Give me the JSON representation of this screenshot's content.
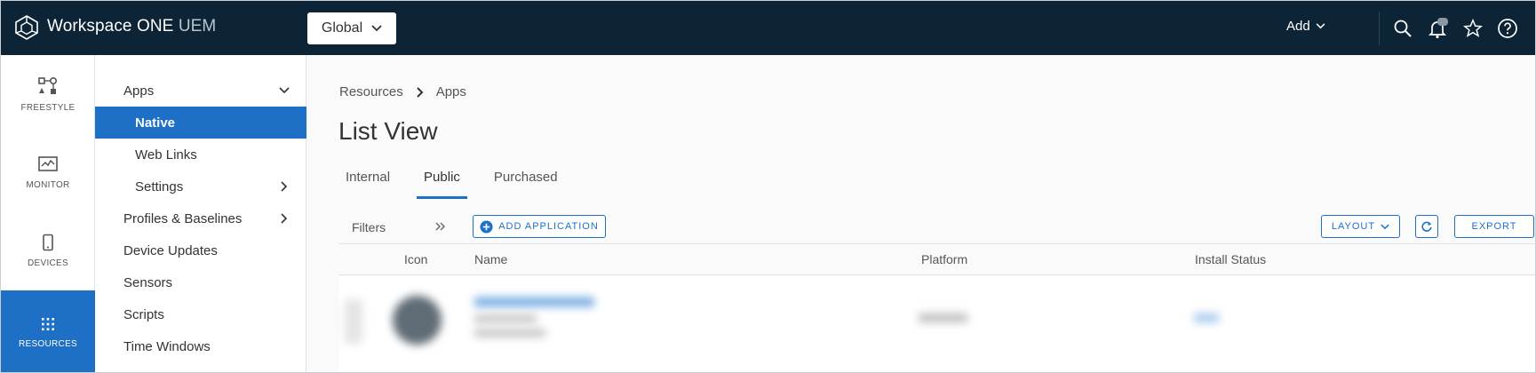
{
  "header": {
    "brand_main": "Workspace ONE",
    "brand_suffix": "UEM",
    "org_selector": "Global",
    "add_menu": "Add"
  },
  "rail": {
    "items": [
      {
        "label": "FREESTYLE",
        "icon": "freestyle-icon"
      },
      {
        "label": "MONITOR",
        "icon": "monitor-icon"
      },
      {
        "label": "DEVICES",
        "icon": "device-icon"
      },
      {
        "label": "RESOURCES",
        "icon": "resources-grid-icon",
        "active": true
      }
    ]
  },
  "subnav": {
    "items": [
      {
        "label": "Apps",
        "level": "top",
        "expanded": true
      },
      {
        "label": "Native",
        "level": "child",
        "active": true
      },
      {
        "label": "Web Links",
        "level": "child"
      },
      {
        "label": "Settings",
        "level": "child",
        "has_children": true
      },
      {
        "label": "Profiles & Baselines",
        "level": "top",
        "has_children": true
      },
      {
        "label": "Device Updates",
        "level": "top"
      },
      {
        "label": "Sensors",
        "level": "top"
      },
      {
        "label": "Scripts",
        "level": "top"
      },
      {
        "label": "Time Windows",
        "level": "top"
      }
    ]
  },
  "main": {
    "breadcrumb": [
      "Resources",
      "Apps"
    ],
    "title": "List View",
    "tabs": [
      {
        "label": "Internal"
      },
      {
        "label": "Public",
        "active": true
      },
      {
        "label": "Purchased"
      }
    ],
    "toolbar": {
      "filters_label": "Filters",
      "add_application": "ADD APPLICATION",
      "layout": "LAYOUT",
      "export": "EXPORT"
    },
    "grid": {
      "columns": [
        "Icon",
        "Name",
        "Platform",
        "Install Status"
      ]
    }
  },
  "colors": {
    "topbar": "#0d2436",
    "accent": "#1e6fc6"
  }
}
